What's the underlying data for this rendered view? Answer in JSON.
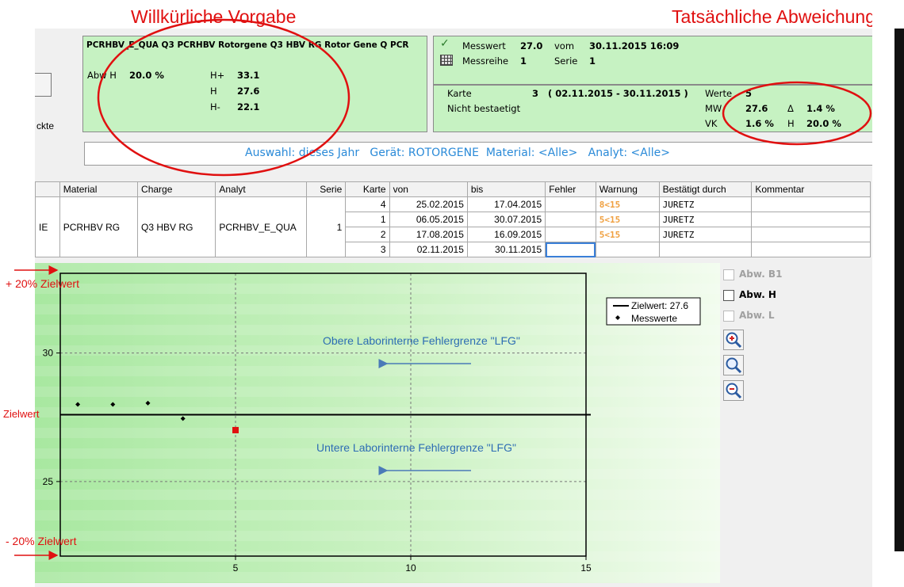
{
  "annotations": {
    "top_left_title": "Willkürliche Vorgabe",
    "top_right_title": "Tatsächliche Abweichung",
    "upper_limit": "+ 20% Zielwert",
    "target": "Zielwert",
    "lower_limit": "- 20% Zielwert",
    "upper_lfg": "Obere Laborinterne Fehlergrenze \"LFG\"",
    "lower_lfg": "Untere Laborinterne Fehlergrenze \"LFG\""
  },
  "left_stub": {
    "label": "ckte"
  },
  "spec_panel": {
    "header": "PCRHBV_E_QUA Q3 PCRHBV Rotorgene Q3 HBV RG Rotor Gene Q PCR",
    "abw_label": "Abw H",
    "abw_value": "20.0 %",
    "limits": [
      {
        "label": "H+",
        "value": "33.1"
      },
      {
        "label": "H",
        "value": "27.6"
      },
      {
        "label": "H-",
        "value": "22.1"
      }
    ]
  },
  "measure_panel": {
    "messwert_label": "Messwert",
    "messwert_value": "27.0",
    "vom_label": "vom",
    "vom_value": "30.11.2015 16:09",
    "messreihe_label": "Messreihe",
    "messreihe_value": "1",
    "serie_label": "Serie",
    "serie_value": "1"
  },
  "card_panel": {
    "karte_label": "Karte",
    "karte_value": "3",
    "karte_range": "( 02.11.2015 - 30.11.2015 )",
    "werte_label": "Werte",
    "werte_value": "5",
    "status": "Nicht bestaetigt",
    "mw_label": "MW",
    "mw_value": "27.6",
    "delta_label": "Δ",
    "delta_value": "1.4 %",
    "vk_label": "VK",
    "vk_value": "1.6 %",
    "h_label": "H",
    "h_value": "20.0 %"
  },
  "filter_bar": {
    "text": "Auswahl: dieses Jahr   Gerät: ROTORGENE  Material: <Alle>   Analyt: <Alle>"
  },
  "table": {
    "headers": [
      "Material",
      "Charge",
      "Analyt",
      "Serie",
      "Karte",
      "von",
      "bis",
      "Fehler",
      "Warnung",
      "Bestätigt durch",
      "Kommentar"
    ],
    "first_col_stub": "IE",
    "group": {
      "material": "PCRHBV RG",
      "charge": "Q3 HBV RG",
      "analyt": "PCRHBV_E_QUA",
      "serie": "1"
    },
    "rows": [
      {
        "karte": "4",
        "von": "25.02.2015",
        "bis": "17.04.2015",
        "fehler": "",
        "warnung": "8<15",
        "bestaetigt": "JURETZ",
        "kommentar": ""
      },
      {
        "karte": "1",
        "von": "06.05.2015",
        "bis": "30.07.2015",
        "fehler": "",
        "warnung": "5<15",
        "bestaetigt": "JURETZ",
        "kommentar": ""
      },
      {
        "karte": "2",
        "von": "17.08.2015",
        "bis": "16.09.2015",
        "fehler": "",
        "warnung": "5<15",
        "bestaetigt": "JURETZ",
        "kommentar": ""
      },
      {
        "karte": "3",
        "von": "02.11.2015",
        "bis": "30.11.2015",
        "fehler": "",
        "warnung": "",
        "bestaetigt": "",
        "kommentar": ""
      }
    ],
    "warn_color": "#f0a040"
  },
  "options": {
    "checkboxes": [
      {
        "label": "Abw. B1",
        "checked": false,
        "enabled": false
      },
      {
        "label": "Abw. H",
        "checked": false,
        "enabled": true
      },
      {
        "label": "Abw. L",
        "checked": false,
        "enabled": false
      }
    ],
    "zoom_icons": [
      "zoom-in-icon",
      "zoom-reset-icon",
      "zoom-out-icon"
    ]
  },
  "chart_data": {
    "type": "scatter",
    "xlim": [
      0,
      15
    ],
    "ylim": [
      22.1,
      33.1
    ],
    "x_ticks": [
      5,
      10,
      15
    ],
    "y_ticks": [
      25,
      30
    ],
    "gridlines": "dashed",
    "target_line": 27.6,
    "legend": {
      "target_label": "Zielwert: 27.6",
      "points_label": "Messwerte",
      "placement": "top-right"
    },
    "points": [
      {
        "x": 0.5,
        "y": 28.0
      },
      {
        "x": 1.5,
        "y": 28.0
      },
      {
        "x": 2.5,
        "y": 28.05
      },
      {
        "x": 3.5,
        "y": 27.45
      },
      {
        "x": 5.0,
        "y": 27.0,
        "current": true
      }
    ],
    "point_color": "#000000",
    "current_point_color": "#e01010"
  }
}
